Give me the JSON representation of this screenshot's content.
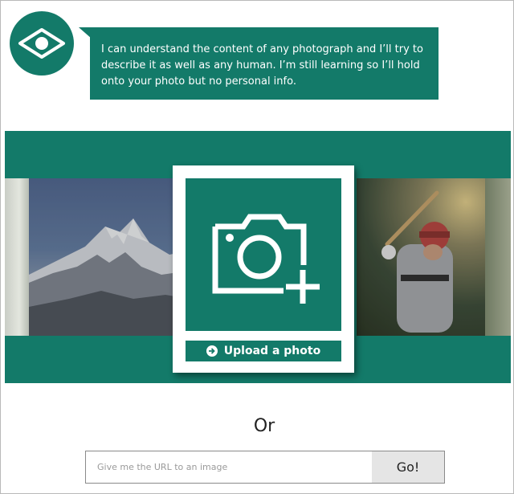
{
  "intro": {
    "message": "I can understand the content of any photograph and I’ll try to describe it as well as any human. I’m still learning so I’ll hold onto your photo but no personal info."
  },
  "banner": {
    "photos": [
      "mountain-photo",
      "baseball-photo"
    ]
  },
  "upload": {
    "button_label": "Upload a photo"
  },
  "alt": {
    "or_label": "Or"
  },
  "url_form": {
    "placeholder": "Give me the URL to an image",
    "value": "",
    "go_label": "Go!"
  },
  "colors": {
    "brand_teal": "#137a69",
    "go_button_bg": "#e5e5e5"
  },
  "icons": {
    "logo": "eye-diamond-icon",
    "upload_area": "camera-plus-icon",
    "upload_button": "arrow-right-circle-icon"
  }
}
